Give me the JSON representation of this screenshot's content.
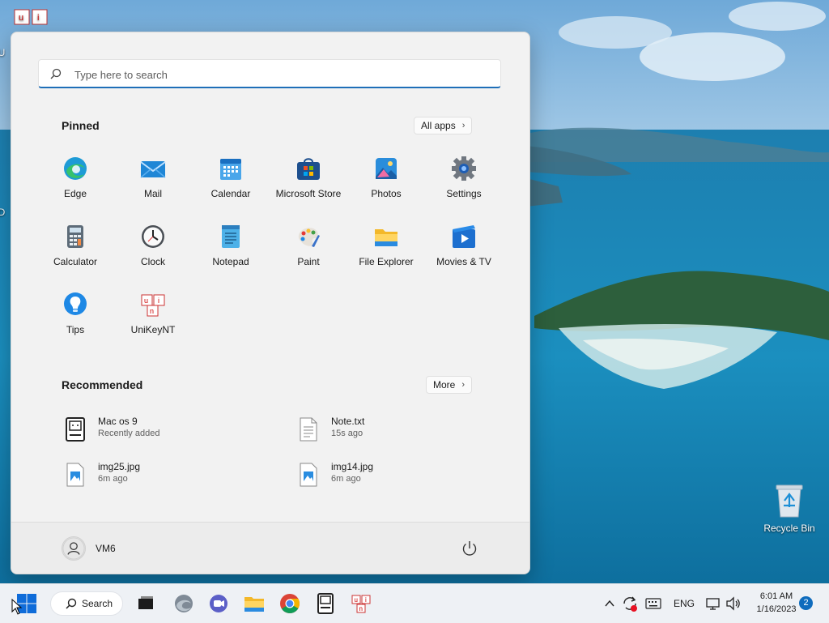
{
  "desktop": {
    "recycle_bin_label": "Recycle Bin",
    "clipped_label_top": "U",
    "clipped_label_mid": "D"
  },
  "start_menu": {
    "search_placeholder": "Type here to search",
    "pinned_title": "Pinned",
    "all_apps_label": "All apps",
    "pinned_apps": [
      {
        "label": "Edge",
        "icon": "edge-icon"
      },
      {
        "label": "Mail",
        "icon": "mail-icon"
      },
      {
        "label": "Calendar",
        "icon": "calendar-icon"
      },
      {
        "label": "Microsoft Store",
        "icon": "store-icon"
      },
      {
        "label": "Photos",
        "icon": "photos-icon"
      },
      {
        "label": "Settings",
        "icon": "gear-icon"
      },
      {
        "label": "Calculator",
        "icon": "calculator-icon"
      },
      {
        "label": "Clock",
        "icon": "clock-icon"
      },
      {
        "label": "Notepad",
        "icon": "notepad-icon"
      },
      {
        "label": "Paint",
        "icon": "paint-icon"
      },
      {
        "label": "File Explorer",
        "icon": "folder-icon"
      },
      {
        "label": "Movies & TV",
        "icon": "movies-icon"
      },
      {
        "label": "Tips",
        "icon": "lightbulb-icon"
      },
      {
        "label": "UniKeyNT",
        "icon": "unikey-icon"
      }
    ],
    "recommended_title": "Recommended",
    "more_label": "More",
    "recommended": [
      {
        "name": "Mac os 9",
        "sub": "Recently added",
        "icon": "mac-app-icon"
      },
      {
        "name": "Note.txt",
        "sub": "15s ago",
        "icon": "text-file-icon"
      },
      {
        "name": "img25.jpg",
        "sub": "6m ago",
        "icon": "image-file-icon"
      },
      {
        "name": "img14.jpg",
        "sub": "6m ago",
        "icon": "image-file-icon"
      }
    ],
    "user_name": "VM6"
  },
  "taskbar": {
    "search_label": "Search",
    "language": "ENG",
    "time": "6:01 AM",
    "date": "1/16/2023",
    "notification_count": "2"
  },
  "colors": {
    "accent": "#1f6fb8",
    "menu_bg": "#f2f2f2",
    "taskbar_bg": "#eef1f5"
  }
}
